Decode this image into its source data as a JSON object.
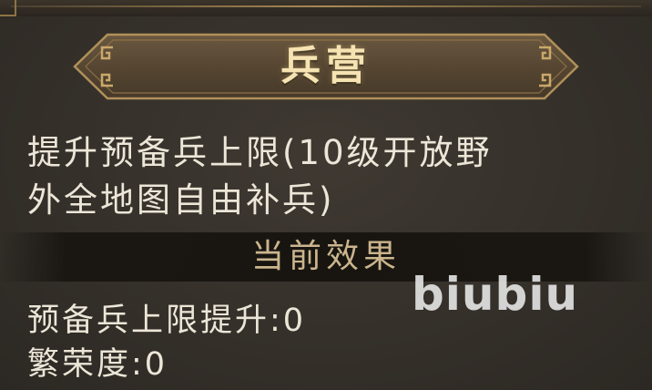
{
  "header": {
    "title": "兵营"
  },
  "description": {
    "line1": "提升预备兵上限(10级开放野",
    "line2": "外全地图自由补兵)"
  },
  "section": {
    "title": "当前效果"
  },
  "effects": [
    {
      "label": "预备兵上限提升:0"
    },
    {
      "label": "繁荣度:0"
    }
  ],
  "watermark": "biubiu",
  "colors": {
    "background": "#35302a",
    "banner_fill": "#5a4a36",
    "gold_border": "#b0905a",
    "title_text": "#f6e3b2",
    "body_text": "#ece6d8",
    "section_text": "#cbb58d"
  },
  "icons": [
    "banner-ornament-left-icon",
    "banner-ornament-right-icon"
  ]
}
